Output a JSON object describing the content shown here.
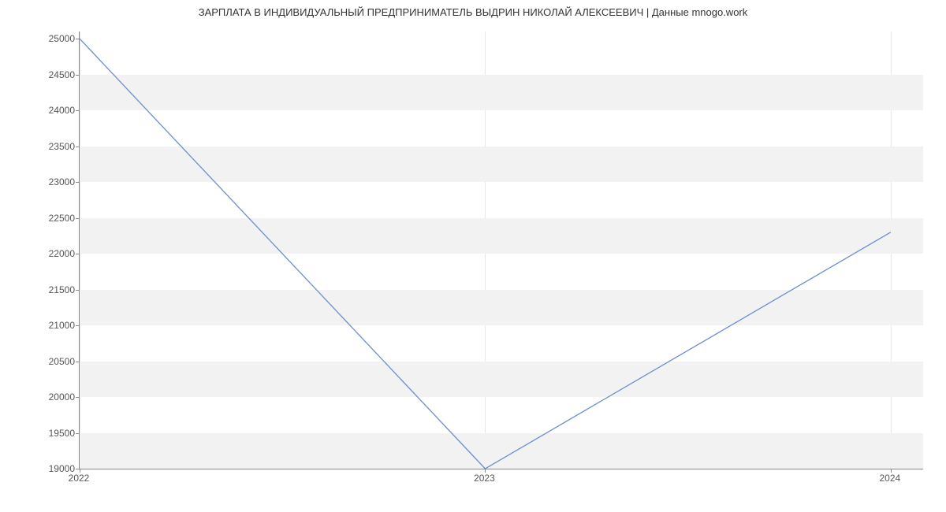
{
  "chart_data": {
    "type": "line",
    "title": "ЗАРПЛАТА В ИНДИВИДУАЛЬНЫЙ ПРЕДПРИНИМАТЕЛЬ ВЫДРИН НИКОЛАЙ АЛЕКСЕЕВИЧ | Данные mnogo.work",
    "x": [
      2022,
      2023,
      2024
    ],
    "values": [
      25000,
      19000,
      22300
    ],
    "xlabel": "",
    "ylabel": "",
    "y_ticks": [
      19000,
      19500,
      20000,
      20500,
      21000,
      21500,
      22000,
      22500,
      23000,
      23500,
      24000,
      24500,
      25000
    ],
    "x_ticks": [
      2022,
      2023,
      2024
    ],
    "xlim": [
      2022,
      2024.08
    ],
    "ylim": [
      19000,
      25100
    ],
    "line_color": "#6a8fce"
  }
}
